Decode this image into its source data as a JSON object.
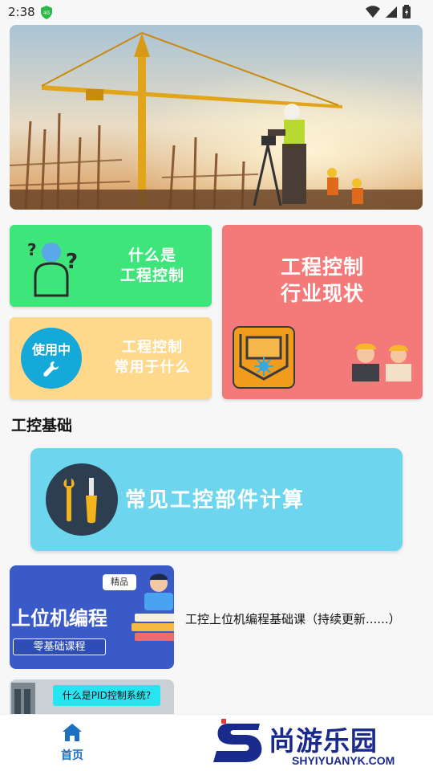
{
  "status_bar": {
    "time": "2:38"
  },
  "cards": {
    "what_is_line1": "什么是",
    "what_is_line2": "工程控制",
    "industry_line1": "工程控制",
    "industry_line2": "行业现状",
    "usage_badge": "使用中",
    "usage_line1": "工程控制",
    "usage_line2": "常用于什么"
  },
  "section": {
    "title": "工控基础"
  },
  "feature": {
    "label": "常见工控部件计算"
  },
  "courses": [
    {
      "thumb_title": "上位机编程",
      "thumb_sub": "零基础课程",
      "thumb_tag": "精品",
      "title": "工控上位机编程基础课（持续更新......）"
    },
    {
      "thumb_tag": "什么是PID控制系统?"
    }
  ],
  "nav": {
    "home_label": "首页"
  },
  "watermark": {
    "brand": "尚游乐园",
    "url": "SHYIYUANYK.COM"
  },
  "colors": {
    "green_card": "#3de57a",
    "yellow_card": "#fed88b",
    "red_card": "#f47a7a",
    "feature_card": "#6dd5ee",
    "nav_active": "#1d6fc1"
  }
}
